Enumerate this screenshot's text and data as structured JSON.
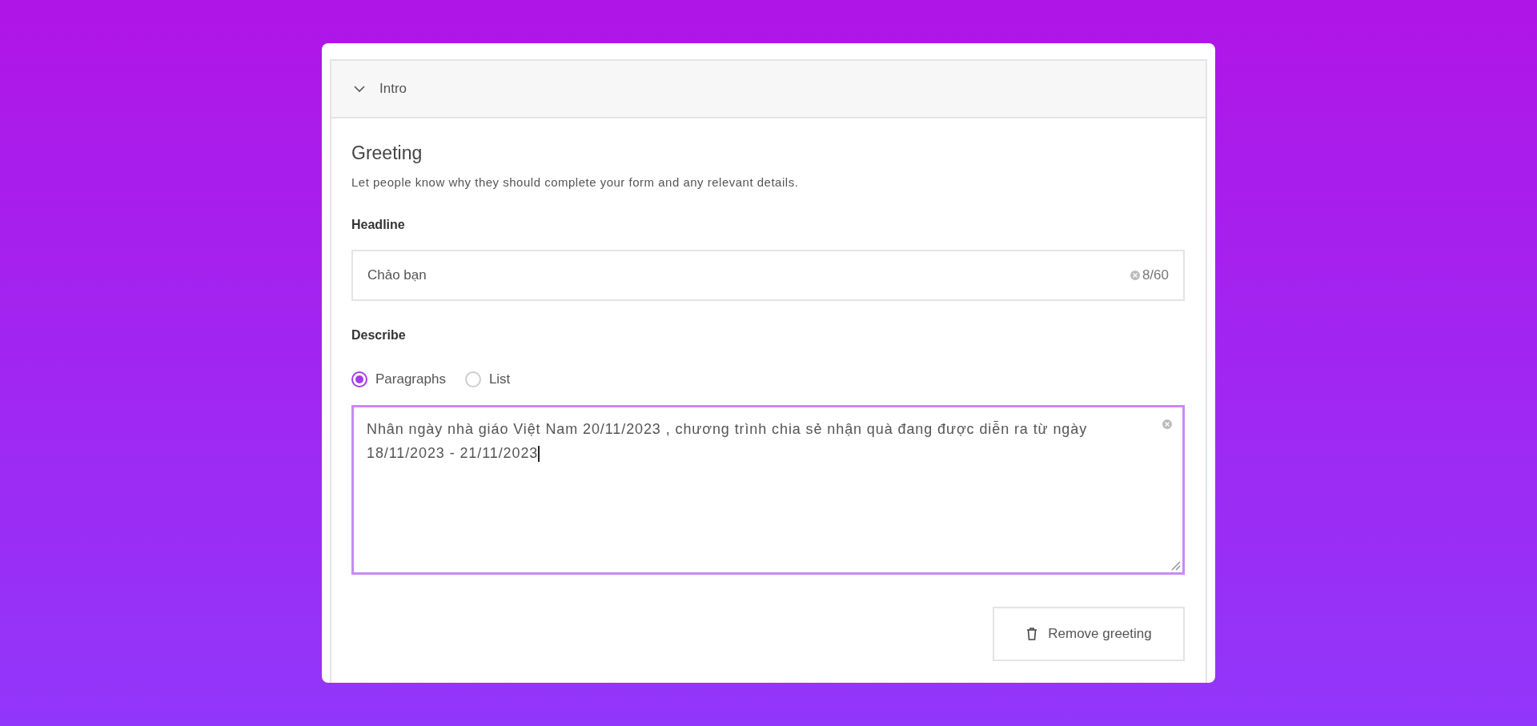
{
  "section": {
    "title": "Intro",
    "expanded": true
  },
  "greeting": {
    "title": "Greeting",
    "description": "Let people know why they should complete your form and any relevant details."
  },
  "headline": {
    "label": "Headline",
    "value": "Chảo bạn",
    "counter": "8/60"
  },
  "describe": {
    "label": "Describe",
    "options": [
      {
        "label": "Paragraphs",
        "selected": true
      },
      {
        "label": "List",
        "selected": false
      }
    ],
    "value": "Nhân ngày nhà giáo Việt Nam 20/11/2023 , chương trình chia sẻ nhận quà đang được diễn ra từ ngày 18/11/2023 - 21/11/2023"
  },
  "remove_button": "Remove greeting"
}
